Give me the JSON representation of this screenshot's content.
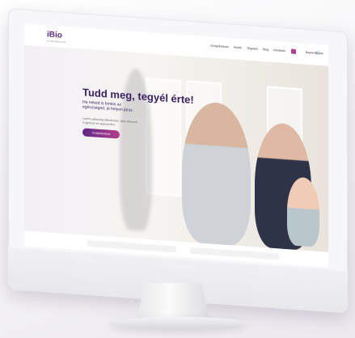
{
  "logo": {
    "main": "iBio",
    "tagline": "az egeszseg elott"
  },
  "nav": [
    "Szolgáltatások",
    "Akciók",
    "Tegyetek",
    "Blog",
    "Kérdések"
  ],
  "login": "Bejelentkezés",
  "hero": {
    "title": "Tudd meg, tegyél érte!",
    "subtitle": "Ha neked is fontos az egészséged, jó helyen jársz.",
    "body": "Lorem egészség ellenőrzése, akár otthonról is gyorsan és egyszerűen.",
    "cta": "Szolgáltatások"
  },
  "colors": {
    "brand": "#5b2a86",
    "accent": "#b83c8e"
  }
}
